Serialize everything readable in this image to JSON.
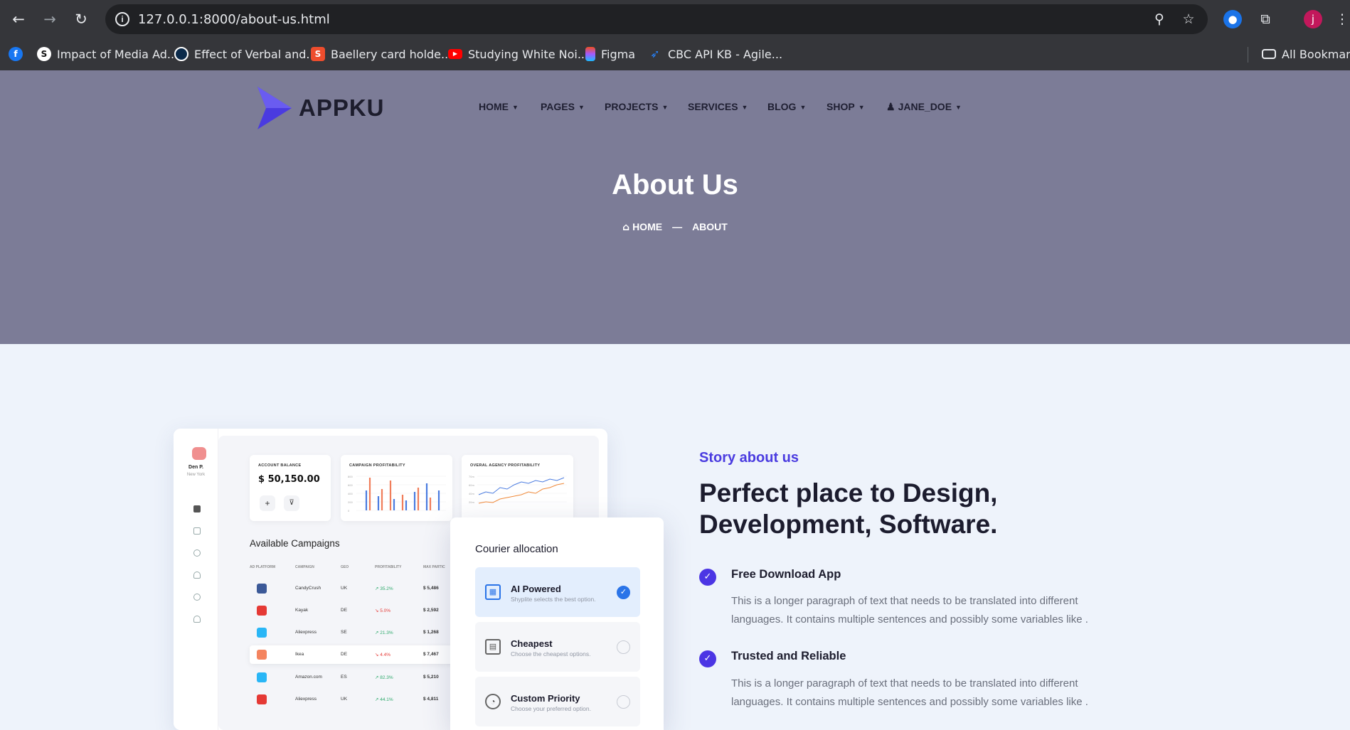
{
  "browser": {
    "url": "127.0.0.1:8000/about-us.html",
    "profile_initial": "j",
    "bookmarks": [
      {
        "label": "Impact of Media Ad...",
        "icon": "s-logo-icon"
      },
      {
        "label": "Effect of Verbal and...",
        "icon": "circle-logo-icon"
      },
      {
        "label": "Baellery card holde...",
        "icon": "shopping-bag-icon"
      },
      {
        "label": "Studying White Noi...",
        "icon": "youtube-icon"
      },
      {
        "label": "Figma",
        "icon": "figma-icon"
      },
      {
        "label": "CBC API KB - Agile...",
        "icon": "jira-icon"
      }
    ],
    "all_bookmarks": "All Bookmarks"
  },
  "site": {
    "logo_text": "APPKU",
    "nav": [
      "HOME",
      "PAGES",
      "PROJECTS",
      "SERVICES",
      "BLOG",
      "SHOP",
      "JANE_DOE"
    ],
    "hero_title": "About Us",
    "breadcrumb_home": "HOME",
    "breadcrumb_sep": "—",
    "breadcrumb_current": "ABOUT"
  },
  "dashboard": {
    "user_name": "Den P.",
    "user_city": "New York",
    "account_balance_label": "ACCOUNT BALANCE",
    "account_balance": "$ 50,150.00",
    "campaign_profitability_label": "CAMPAIGN PROFITABILITY",
    "agency_profitability_label": "OVERAL AGENCY PROFITABILITY",
    "available_campaigns": "Available Campaigns",
    "columns": [
      "AD PLATFORM",
      "CAMPAIGN",
      "GEO",
      "PROFITABILITY",
      "MAX PARTIC"
    ],
    "rows": [
      {
        "platform": "facebook",
        "campaign": "CandyCrush",
        "geo": "UK",
        "profit": "35.2%",
        "max": "$ 5,486",
        "trend": "up"
      },
      {
        "platform": "youtube",
        "campaign": "Kayak",
        "geo": "DE",
        "profit": "5.0%",
        "max": "$ 2,592",
        "trend": "down"
      },
      {
        "platform": "twitter",
        "campaign": "Aliexpress",
        "geo": "SE",
        "profit": "21.3%",
        "max": "$ 1,268",
        "trend": "up"
      },
      {
        "platform": "instagram",
        "campaign": "Ikea",
        "geo": "DE",
        "profit": "4.4%",
        "max": "$ 7,467",
        "trend": "down"
      },
      {
        "platform": "twitter",
        "campaign": "Amazon.com",
        "geo": "ES",
        "profit": "82.3%",
        "max": "$ 5,210",
        "trend": "up"
      },
      {
        "platform": "youtube",
        "campaign": "Aliexpress",
        "geo": "UK",
        "profit": "44.1%",
        "max": "$ 4,811",
        "trend": "up"
      }
    ],
    "courier_title": "Courier allocation",
    "options": [
      {
        "title": "AI Powered",
        "sub": "Shyplite selects the best option.",
        "selected": true
      },
      {
        "title": "Cheapest",
        "sub": "Choose the cheapest options.",
        "selected": false
      },
      {
        "title": "Custom Priority",
        "sub": "Choose your preferred option.",
        "selected": false
      }
    ]
  },
  "story": {
    "subtitle": "Story about us",
    "title": "Perfect place to Design, Development, Software.",
    "features": [
      {
        "title": "Free Download App",
        "text": "This is a longer paragraph of text that needs to be translated into different languages. It contains multiple sentences and possibly some variables like ."
      },
      {
        "title": "Trusted and Reliable",
        "text": "This is a longer paragraph of text that needs to be translated into different languages. It contains multiple sentences and possibly some variables like ."
      }
    ]
  },
  "colors": {
    "hero_bg": "#7c7c97",
    "accent": "#4a3be0",
    "content_bg": "#eef3fb"
  }
}
